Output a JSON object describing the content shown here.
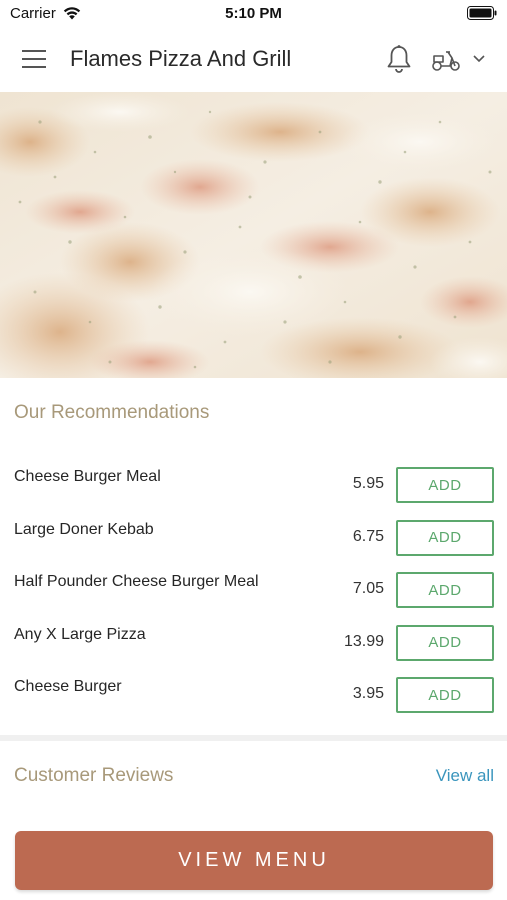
{
  "status_bar": {
    "carrier": "Carrier",
    "time": "5:10 PM",
    "icons": [
      "wifi-icon",
      "battery-icon"
    ]
  },
  "nav": {
    "title": "Flames Pizza And Grill",
    "icons": [
      "menu-icon",
      "bell-icon",
      "scooter-icon",
      "chevron-down-icon"
    ]
  },
  "hero": {
    "image": "pizza-image"
  },
  "recommendations": {
    "heading": "Our Recommendations",
    "items": [
      {
        "name": "Cheese Burger Meal",
        "price": "5.95",
        "action": "ADD"
      },
      {
        "name": "Large Doner Kebab",
        "price": "6.75",
        "action": "ADD"
      },
      {
        "name": "Half Pounder Cheese Burger Meal",
        "price": "7.05",
        "action": "ADD"
      },
      {
        "name": "Any X Large Pizza",
        "price": "13.99",
        "action": "ADD"
      },
      {
        "name": "Cheese Burger",
        "price": "3.95",
        "action": "ADD"
      }
    ]
  },
  "reviews": {
    "heading": "Customer Reviews",
    "view_all": "View all"
  },
  "footer": {
    "view_menu": "VIEW MENU"
  },
  "colors": {
    "accent_heading": "#a8997a",
    "add_button": "#5ca86d",
    "link": "#3a95bd",
    "primary_button": "#bc6a51"
  }
}
